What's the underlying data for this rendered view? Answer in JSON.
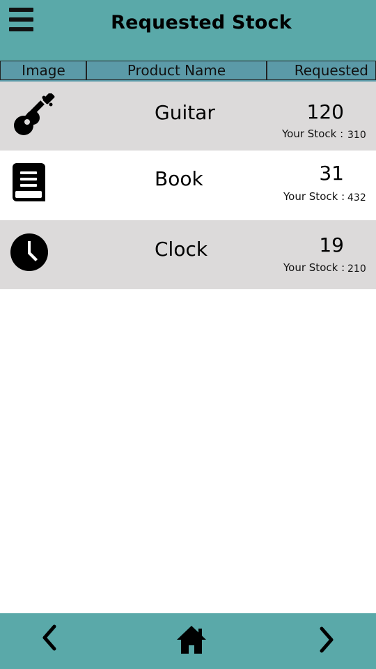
{
  "header": {
    "title": "Requested Stock",
    "menu_icon": "hamburger-menu-icon"
  },
  "columns": {
    "image": "Image",
    "product_name": "Product Name",
    "requested": "Requested"
  },
  "stock_label": "Your Stock :",
  "items": [
    {
      "icon": "guitar-icon",
      "name": "Guitar",
      "requested": "120",
      "stock": "310"
    },
    {
      "icon": "book-icon",
      "name": "Book",
      "requested": "31",
      "stock": "432"
    },
    {
      "icon": "clock-icon",
      "name": "Clock",
      "requested": "19",
      "stock": "210"
    }
  ],
  "footer": {
    "back_icon": "chevron-left-icon",
    "home_icon": "home-icon",
    "forward_icon": "chevron-right-icon"
  },
  "colors": {
    "header_bg": "#5aa9a9",
    "column_header_bg": "#5b9aa8",
    "row_gray": "#dcdada",
    "row_white": "#ffffff"
  }
}
